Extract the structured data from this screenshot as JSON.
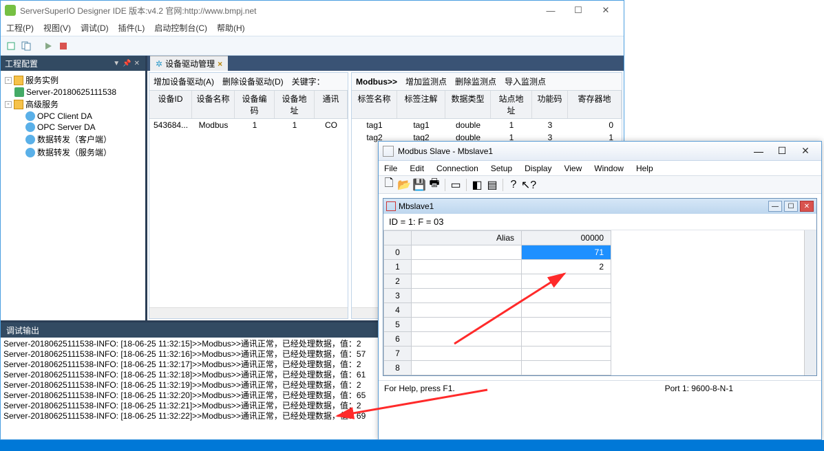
{
  "ide": {
    "title": "ServerSuperIO Designer IDE 版本:v4.2 官网:http://www.bmpj.net",
    "menu": [
      "工程(P)",
      "视图(V)",
      "调试(D)",
      "插件(L)",
      "启动控制台(C)",
      "帮助(H)"
    ],
    "left_panel_title": "工程配置",
    "tree": {
      "root1": "服务实例",
      "server": "Server-20180625111538",
      "root2": "高级服务",
      "svc": [
        "OPC Client DA",
        "OPC Server DA",
        "数据转发（客户端）",
        "数据转发（服务端）"
      ]
    },
    "tab": "设备驱动管理",
    "left_grid": {
      "toolbar": [
        "增加设备驱动(A)",
        "删除设备驱动(D)",
        "关键字："
      ],
      "cols": [
        "设备ID",
        "设备名称",
        "设备编码",
        "设备地址",
        "通讯"
      ],
      "row": [
        "543684...",
        "Modbus",
        "1",
        "1",
        "CO"
      ]
    },
    "right_grid": {
      "toolbar_lead": "Modbus>>",
      "toolbar": [
        "增加监测点",
        "删除监测点",
        "导入监测点"
      ],
      "cols": [
        "标签名称",
        "标签注解",
        "数据类型",
        "站点地址",
        "功能码",
        "寄存器地"
      ],
      "rows": [
        [
          "tag1",
          "tag1",
          "double",
          "1",
          "3",
          "0"
        ],
        [
          "tag2",
          "tag2",
          "double",
          "1",
          "3",
          "1"
        ]
      ]
    },
    "debug_title": "调试输出",
    "debug_lines": [
      "Server-20180625111538-INFO: [18-06-25 11:32:15]>>Modbus>>通讯正常，已经处理数据，值：2",
      "Server-20180625111538-INFO: [18-06-25 11:32:16]>>Modbus>>通讯正常，已经处理数据，值：57",
      "Server-20180625111538-INFO: [18-06-25 11:32:17]>>Modbus>>通讯正常，已经处理数据，值：2",
      "Server-20180625111538-INFO: [18-06-25 11:32:18]>>Modbus>>通讯正常，已经处理数据，值：61",
      "Server-20180625111538-INFO: [18-06-25 11:32:19]>>Modbus>>通讯正常，已经处理数据，值：2",
      "Server-20180625111538-INFO: [18-06-25 11:32:20]>>Modbus>>通讯正常，已经处理数据，值：65",
      "Server-20180625111538-INFO: [18-06-25 11:32:21]>>Modbus>>通讯正常，已经处理数据，值：2",
      "Server-20180625111538-INFO: [18-06-25 11:32:22]>>Modbus>>通讯正常，已经处理数据，值：69"
    ]
  },
  "slave": {
    "title": "Modbus Slave - Mbslave1",
    "menu": [
      "File",
      "Edit",
      "Connection",
      "Setup",
      "Display",
      "View",
      "Window",
      "Help"
    ],
    "doc_title": "Mbslave1",
    "id_line": "ID = 1: F = 03",
    "cols": [
      "",
      "Alias",
      "00000"
    ],
    "rows": [
      {
        "idx": "0",
        "alias": "",
        "val": "71",
        "sel": true
      },
      {
        "idx": "1",
        "alias": "",
        "val": "2"
      },
      {
        "idx": "2",
        "alias": "",
        "val": ""
      },
      {
        "idx": "3",
        "alias": "",
        "val": ""
      },
      {
        "idx": "4",
        "alias": "",
        "val": ""
      },
      {
        "idx": "5",
        "alias": "",
        "val": ""
      },
      {
        "idx": "6",
        "alias": "",
        "val": ""
      },
      {
        "idx": "7",
        "alias": "",
        "val": ""
      },
      {
        "idx": "8",
        "alias": "",
        "val": ""
      }
    ],
    "status_left": "For Help, press F1.",
    "status_right": "Port 1: 9600-8-N-1"
  }
}
